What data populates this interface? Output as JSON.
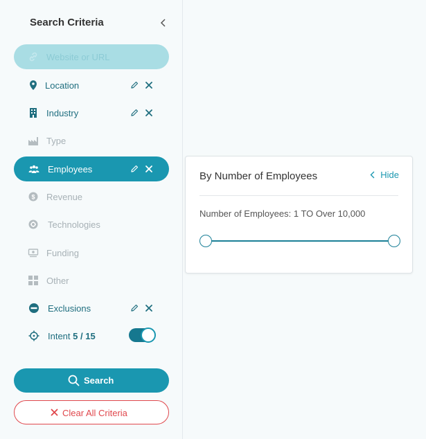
{
  "sidebar": {
    "title": "Search Criteria",
    "items": [
      {
        "label": "Website or URL",
        "state": "url"
      },
      {
        "label": "Location",
        "state": "enabled"
      },
      {
        "label": "Industry",
        "state": "enabled"
      },
      {
        "label": "Type",
        "state": "disabled"
      },
      {
        "label": "Employees",
        "state": "active"
      },
      {
        "label": "Revenue",
        "state": "disabled"
      },
      {
        "label": "Technologies",
        "state": "disabled"
      },
      {
        "label": "Funding",
        "state": "disabled"
      },
      {
        "label": "Other",
        "state": "disabled"
      },
      {
        "label": "Exclusions",
        "state": "enabled"
      }
    ],
    "intent": {
      "label": "Intent",
      "count": "5 / 15",
      "toggle_on": true
    },
    "search_label": "Search",
    "clear_label": "Clear All Criteria"
  },
  "panel": {
    "title": "By Number of Employees",
    "hide_label": "Hide",
    "range_text": "Number of Employees: 1 TO Over 10,000",
    "range": {
      "min_fraction": 0,
      "max_fraction": 1
    }
  },
  "colors": {
    "accent": "#1a97b0",
    "accent_dark": "#16788f",
    "label": "#1f6e7f",
    "disabled": "#a7b1b6",
    "danger": "#e0474c"
  }
}
